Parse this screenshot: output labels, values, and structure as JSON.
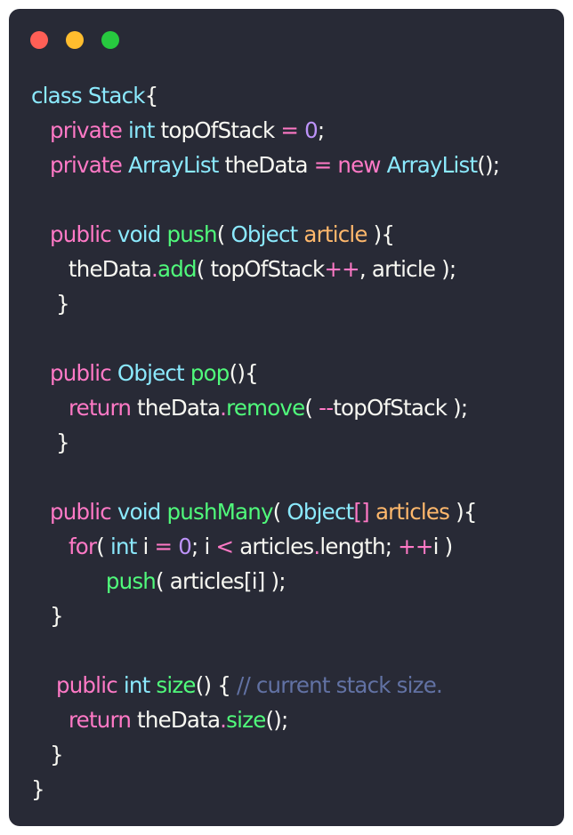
{
  "window": {
    "controls": [
      {
        "name": "close",
        "color": "#ff5f56"
      },
      {
        "name": "minimize",
        "color": "#ffbd2e"
      },
      {
        "name": "maximize",
        "color": "#27c93f"
      }
    ]
  },
  "colors": {
    "background": "#282a36",
    "default": "#f8f8f2",
    "keyword": "#ff79c6",
    "type": "#8be9fd",
    "function": "#50fa7b",
    "number": "#bd93f9",
    "parameter": "#ffb86c",
    "comment": "#6272a4"
  },
  "code": {
    "lines": [
      [
        {
          "t": "class ",
          "k": "type"
        },
        {
          "t": "Stack",
          "k": "type"
        },
        {
          "t": "{",
          "k": "default"
        }
      ],
      [
        {
          "t": "   ",
          "k": "default"
        },
        {
          "t": "private ",
          "k": "keyword"
        },
        {
          "t": "int ",
          "k": "type"
        },
        {
          "t": "topOfStack ",
          "k": "default"
        },
        {
          "t": "= ",
          "k": "keyword"
        },
        {
          "t": "0",
          "k": "number"
        },
        {
          "t": ";",
          "k": "default"
        }
      ],
      [
        {
          "t": "   ",
          "k": "default"
        },
        {
          "t": "private ",
          "k": "keyword"
        },
        {
          "t": "ArrayList ",
          "k": "type"
        },
        {
          "t": "theData ",
          "k": "default"
        },
        {
          "t": "= ",
          "k": "keyword"
        },
        {
          "t": "new ",
          "k": "keyword"
        },
        {
          "t": "ArrayList",
          "k": "type"
        },
        {
          "t": "();",
          "k": "default"
        }
      ],
      [],
      [
        {
          "t": "   ",
          "k": "default"
        },
        {
          "t": "public ",
          "k": "keyword"
        },
        {
          "t": "void ",
          "k": "type"
        },
        {
          "t": "push",
          "k": "function"
        },
        {
          "t": "( ",
          "k": "default"
        },
        {
          "t": "Object ",
          "k": "type"
        },
        {
          "t": "article ",
          "k": "parameter"
        },
        {
          "t": "){",
          "k": "default"
        }
      ],
      [
        {
          "t": "      theData",
          "k": "default"
        },
        {
          "t": ".",
          "k": "keyword"
        },
        {
          "t": "add",
          "k": "function"
        },
        {
          "t": "( topOfStack",
          "k": "default"
        },
        {
          "t": "++",
          "k": "keyword"
        },
        {
          "t": ", article );",
          "k": "default"
        }
      ],
      [
        {
          "t": "    }",
          "k": "default"
        }
      ],
      [],
      [
        {
          "t": "   ",
          "k": "default"
        },
        {
          "t": "public ",
          "k": "keyword"
        },
        {
          "t": "Object ",
          "k": "type"
        },
        {
          "t": "pop",
          "k": "function"
        },
        {
          "t": "(){",
          "k": "default"
        }
      ],
      [
        {
          "t": "      ",
          "k": "default"
        },
        {
          "t": "return ",
          "k": "keyword"
        },
        {
          "t": "theData",
          "k": "default"
        },
        {
          "t": ".",
          "k": "keyword"
        },
        {
          "t": "remove",
          "k": "function"
        },
        {
          "t": "( ",
          "k": "default"
        },
        {
          "t": "--",
          "k": "keyword"
        },
        {
          "t": "topOfStack );",
          "k": "default"
        }
      ],
      [
        {
          "t": "    }",
          "k": "default"
        }
      ],
      [],
      [
        {
          "t": "   ",
          "k": "default"
        },
        {
          "t": "public ",
          "k": "keyword"
        },
        {
          "t": "void ",
          "k": "type"
        },
        {
          "t": "pushMany",
          "k": "function"
        },
        {
          "t": "( ",
          "k": "default"
        },
        {
          "t": "Object",
          "k": "type"
        },
        {
          "t": "[] ",
          "k": "keyword"
        },
        {
          "t": "articles ",
          "k": "parameter"
        },
        {
          "t": "){",
          "k": "default"
        }
      ],
      [
        {
          "t": "      ",
          "k": "default"
        },
        {
          "t": "for",
          "k": "keyword"
        },
        {
          "t": "( ",
          "k": "default"
        },
        {
          "t": "int ",
          "k": "type"
        },
        {
          "t": "i ",
          "k": "default"
        },
        {
          "t": "= ",
          "k": "keyword"
        },
        {
          "t": "0",
          "k": "number"
        },
        {
          "t": "; i ",
          "k": "default"
        },
        {
          "t": "< ",
          "k": "keyword"
        },
        {
          "t": "articles",
          "k": "default"
        },
        {
          "t": ".",
          "k": "keyword"
        },
        {
          "t": "length; ",
          "k": "default"
        },
        {
          "t": "++",
          "k": "keyword"
        },
        {
          "t": "i )",
          "k": "default"
        }
      ],
      [
        {
          "t": "            ",
          "k": "default"
        },
        {
          "t": "push",
          "k": "function"
        },
        {
          "t": "( articles[i] );",
          "k": "default"
        }
      ],
      [
        {
          "t": "   }",
          "k": "default"
        }
      ],
      [],
      [
        {
          "t": "    ",
          "k": "default"
        },
        {
          "t": "public ",
          "k": "keyword"
        },
        {
          "t": "int ",
          "k": "type"
        },
        {
          "t": "size",
          "k": "function"
        },
        {
          "t": "() { ",
          "k": "default"
        },
        {
          "t": "// current stack size.",
          "k": "comment"
        }
      ],
      [
        {
          "t": "      ",
          "k": "default"
        },
        {
          "t": "return ",
          "k": "keyword"
        },
        {
          "t": "theData",
          "k": "default"
        },
        {
          "t": ".",
          "k": "keyword"
        },
        {
          "t": "size",
          "k": "function"
        },
        {
          "t": "();",
          "k": "default"
        }
      ],
      [
        {
          "t": "   }",
          "k": "default"
        }
      ],
      [
        {
          "t": "}",
          "k": "default"
        }
      ]
    ]
  }
}
